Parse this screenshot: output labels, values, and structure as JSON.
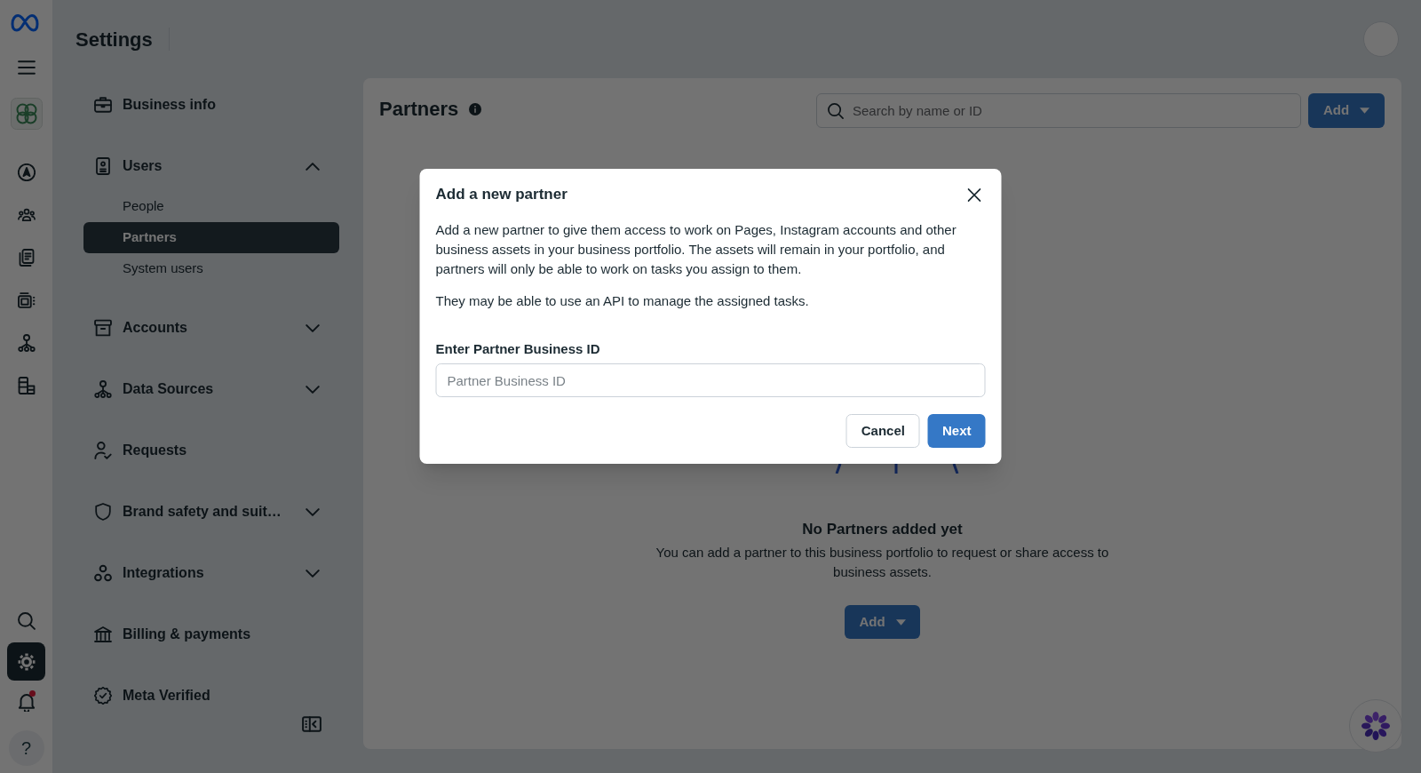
{
  "rail": {
    "nav_items": [
      {
        "selected": false
      },
      {
        "selected": false
      },
      {
        "selected": false
      },
      {
        "selected": false
      },
      {
        "selected": false
      },
      {
        "selected": false
      }
    ],
    "bottom_items": [
      {
        "selected": false,
        "notification": false
      },
      {
        "selected": true,
        "notification": false
      },
      {
        "selected": false,
        "notification": true
      }
    ],
    "help": "?"
  },
  "header": {
    "title": "Settings"
  },
  "sidebar": {
    "items": [
      {
        "label": "Business info",
        "kind": "link",
        "selected": false
      },
      {
        "label": "Users",
        "kind": "group",
        "selected": false,
        "expanded": true,
        "children": [
          {
            "label": "People",
            "selected": false
          },
          {
            "label": "Partners",
            "selected": true
          },
          {
            "label": "System users",
            "selected": false
          }
        ]
      },
      {
        "label": "Accounts",
        "kind": "group",
        "selected": false,
        "expanded": false
      },
      {
        "label": "Data Sources",
        "kind": "group",
        "selected": false,
        "expanded": false
      },
      {
        "label": "Requests",
        "kind": "link",
        "selected": false
      },
      {
        "label": "Brand safety and suit…",
        "kind": "group",
        "selected": false,
        "expanded": false
      },
      {
        "label": "Integrations",
        "kind": "group",
        "selected": false,
        "expanded": false
      },
      {
        "label": "Billing & payments",
        "kind": "link",
        "selected": false
      },
      {
        "label": "Meta Verified",
        "kind": "link",
        "selected": false
      }
    ]
  },
  "main": {
    "title": "Partners",
    "search": {
      "placeholder": "Search by name or ID"
    },
    "add_button": {
      "label": "Add"
    },
    "empty_state": {
      "title": "No Partners added yet",
      "text": "You can add a partner to this business portfolio to request or share access to business assets.",
      "button": {
        "label": "Add"
      }
    }
  },
  "dialog": {
    "title": "Add a new partner",
    "paragraphs": [
      "Add a new partner to give them access to work on Pages, Instagram accounts and other business assets in your business portfolio. The assets will remain in your portfolio, and partners will only be able to work on tasks you assign to them.",
      "They may be able to use an API to manage the assigned tasks."
    ],
    "field": {
      "label": "Enter Partner Business ID",
      "placeholder": "Partner Business ID"
    },
    "buttons": [
      {
        "label": "Cancel",
        "kind": "secondary"
      },
      {
        "label": "Next",
        "kind": "primary"
      }
    ]
  }
}
